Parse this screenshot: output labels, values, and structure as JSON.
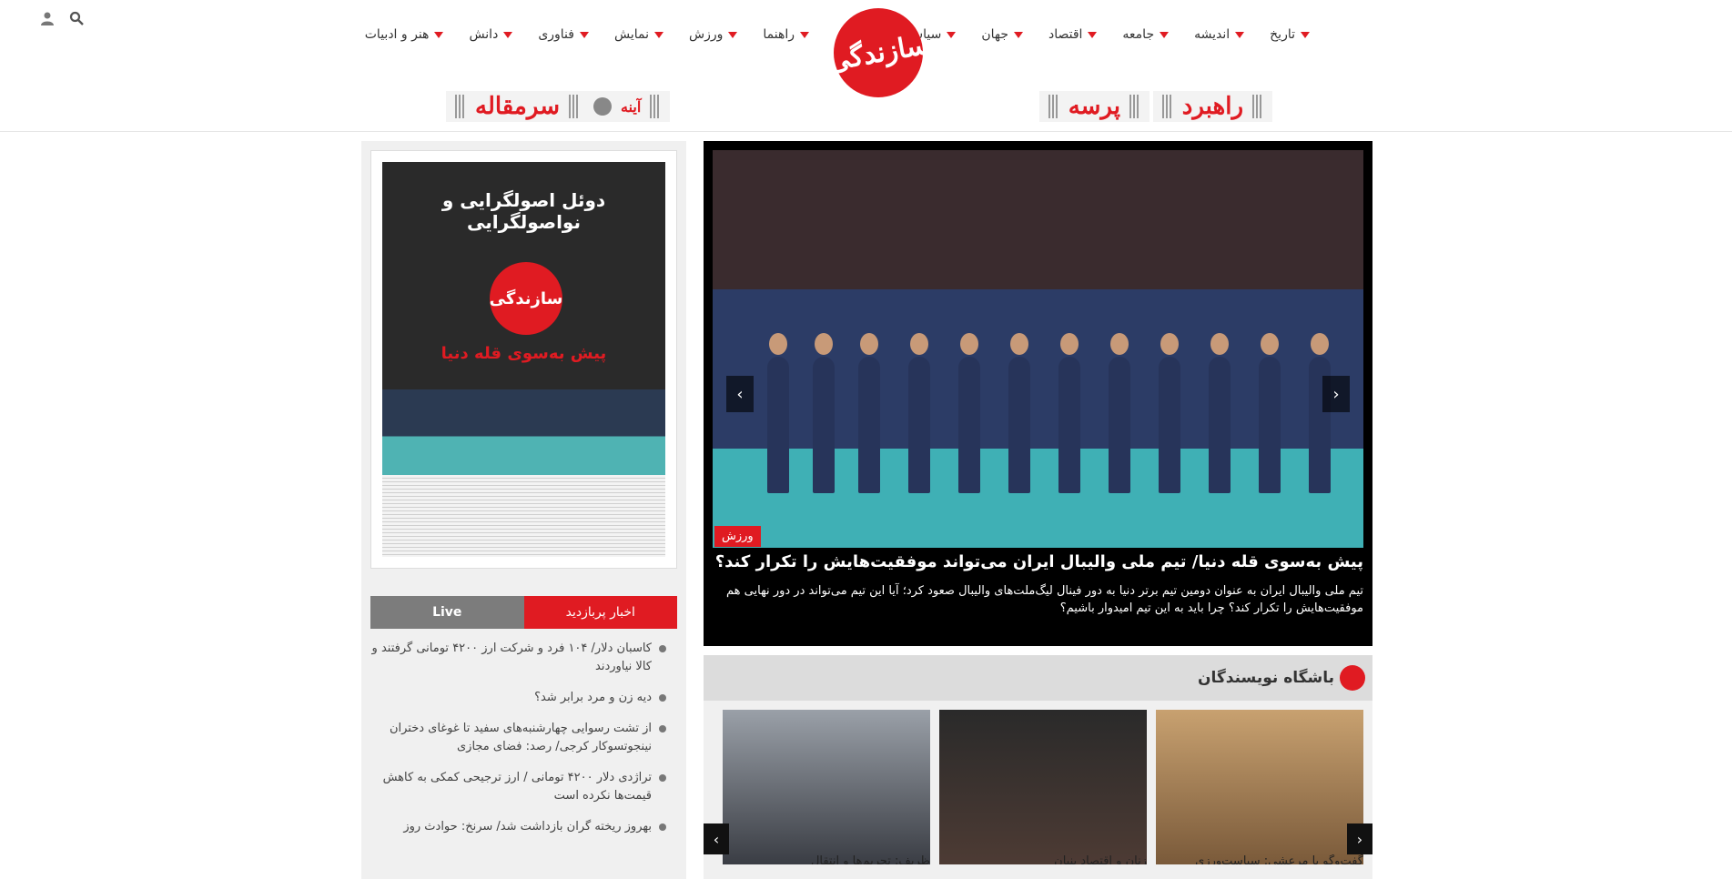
{
  "header": {
    "logo_text": "سازندگی",
    "nav_right": [
      "سیاست",
      "جهان",
      "اقتصاد",
      "جامعه",
      "اندیشه",
      "تاریخ"
    ],
    "nav_left": [
      "هنر و ادبیات",
      "دانش",
      "فناوری",
      "نمایش",
      "ورزش",
      "راهنما"
    ],
    "sections": [
      "راهبرد",
      "پرسه",
      "آینه",
      "سرمقاله"
    ]
  },
  "newspaper": {
    "title": "دوئل اصولگرایی و نواصولگرایی",
    "logo": "سازندگی",
    "headline": "پیش به‌سوی قله دنیا"
  },
  "tabs": {
    "active": "اخبار پربازدید",
    "inactive": "Live"
  },
  "news_list": [
    "کاسبان دلار/ ۱۰۴ فرد و شرکت ارز ۴۲۰۰ تومانی گرفتند و کالا نیاوردند",
    "دیه زن و مرد برابر شد؟",
    "از تشت رسوایی چهارشنبه‌های سفید تا غوغای دختران نینجوتسوکار کرجی/ رصد: فضای مجازی",
    "تراژدی دلار ۴۲۰۰ تومانی / ارز ترجیحی کمکی به کاهش قیمت‌ها نکرده است",
    "بهروز ریخته گران بازداشت شد/ سرنخ: حوادث روز"
  ],
  "slider": {
    "tag": "ورزش",
    "title": "پیش به‌سوی قله دنیا/ تیم ملی والیبال ایران می‌تواند موفقیت‌هایش را تکرار کند؟",
    "lead": "تیم ملی والیبال ایران به عنوان دومین تیم برتر دنیا به دور فینال لیگ‌ملت‌های والیبال صعود کرد؛ آیا این تیم می‌تواند در دور نهایی هم موفقیت‌هایش را تکرار کند؟ چرا باید به این تیم امیدوار باشیم؟"
  },
  "writers": {
    "heading": "باشگاه نویسندگان",
    "cards": [
      {
        "title": "گفت‌وگو با مرعشی: سیاست‌ورزی"
      },
      {
        "title": "زنان و اقتصاد بنیان"
      },
      {
        "title": "ظریف: تحریم‌ها و انتقال"
      }
    ]
  }
}
